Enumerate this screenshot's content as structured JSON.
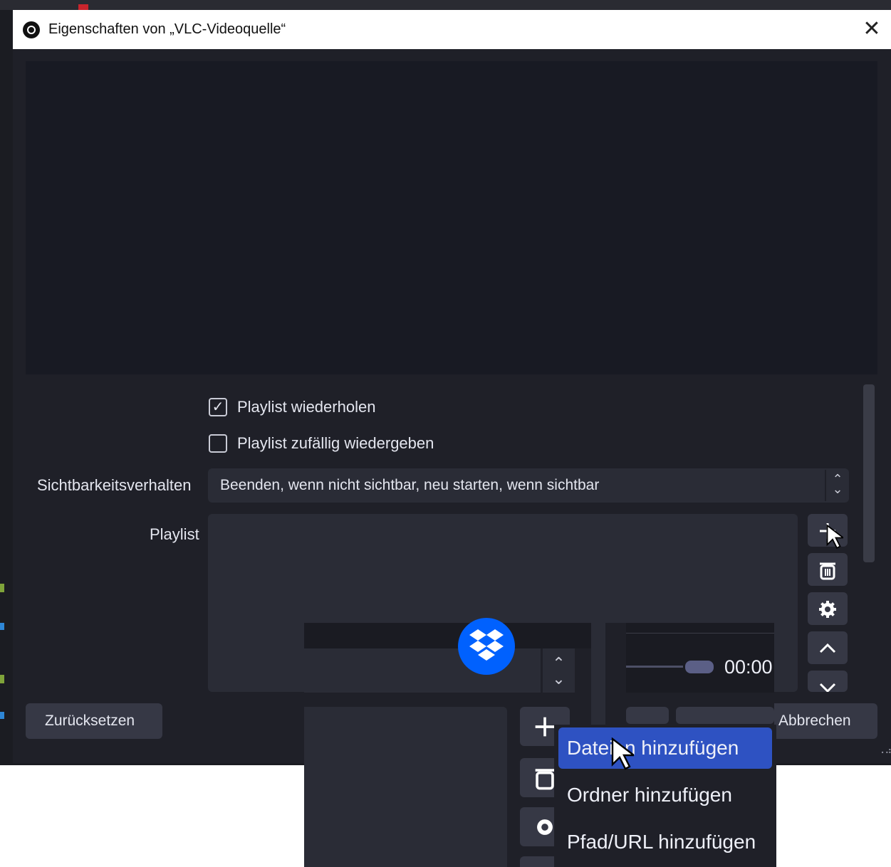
{
  "dialog": {
    "title": "Eigenschaften von „VLC-Videoquelle“",
    "close_glyph": "✕"
  },
  "options": {
    "loop_label": "Playlist wiederholen",
    "loop_checked": true,
    "shuffle_label": "Playlist zufällig wiedergeben",
    "shuffle_checked": false,
    "visibility_label": "Sichtbarkeitsverhalten",
    "visibility_value": "Beenden, wenn nicht sichtbar, neu starten, wenn sichtbar",
    "playlist_label": "Playlist"
  },
  "playlist_buttons": [
    "plus-icon",
    "trash-icon",
    "gear-icon",
    "chevron-up-icon",
    "chevron-down-icon"
  ],
  "footer": {
    "reset_label": "Zurücksetzen",
    "cancel_label": "Abbrechen"
  },
  "zoom": {
    "time_text": "00:00"
  },
  "context_menu": {
    "items": [
      "Dateien hinzufügen",
      "Ordner hinzufügen",
      "Pfad/URL hinzufügen"
    ],
    "active_index": 0
  },
  "colors": {
    "dialog_bg": "#1f2028",
    "panel_bg": "#2a2c36",
    "menu_highlight": "#2e52c2",
    "dropbox_blue": "#0061fe"
  }
}
